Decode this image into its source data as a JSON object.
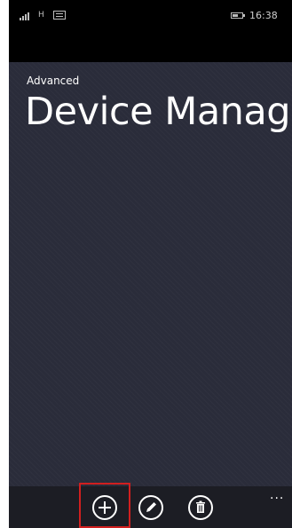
{
  "status_bar": {
    "network": "H",
    "time": "16:38",
    "battery_level": 0.6,
    "icons": [
      "signal-icon",
      "message-icon",
      "battery-icon"
    ]
  },
  "app": {
    "subtitle": "Advanced",
    "title": "Device Manager"
  },
  "app_bar": {
    "buttons": [
      {
        "name": "add-button",
        "icon": "plus-icon",
        "highlighted": true
      },
      {
        "name": "edit-button",
        "icon": "pencil-icon"
      },
      {
        "name": "delete-button",
        "icon": "trash-icon"
      }
    ],
    "more": "..."
  },
  "colors": {
    "background": "#2a2c3a",
    "app_bar": "#1c1d24",
    "highlight": "#d11f1f"
  }
}
